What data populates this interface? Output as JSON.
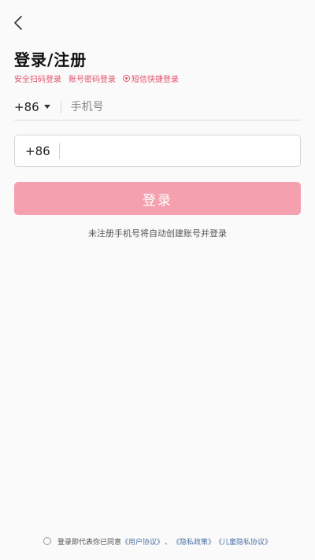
{
  "header": {
    "title": "登录/注册"
  },
  "login_modes": [
    {
      "label": "安全扫码登录"
    },
    {
      "label": "账号密码登录"
    },
    {
      "label": "短信快捷登录",
      "active": true
    }
  ],
  "phone_row": {
    "country_code": "+86",
    "placeholder": "手机号"
  },
  "box_input": {
    "country_code": "+86",
    "value": ""
  },
  "login_button": {
    "label": "登录"
  },
  "hint_text": "未注册手机号将自动创建账号并登录",
  "agreement": {
    "prefix": "登录即代表你已同意",
    "user_agreement": "《用户协议》",
    "sep1": "、",
    "privacy_policy": "《隐私政策》",
    "children_privacy": "《儿童隐私协议》"
  },
  "colors": {
    "accent": "#e2526a",
    "button_bg": "#f4a0ae",
    "link": "#4a6fa5",
    "background": "#fafafa"
  },
  "icons": {
    "back": "chevron-left-icon",
    "caret": "caret-down-icon",
    "active_mode": "radio-dot-icon"
  }
}
